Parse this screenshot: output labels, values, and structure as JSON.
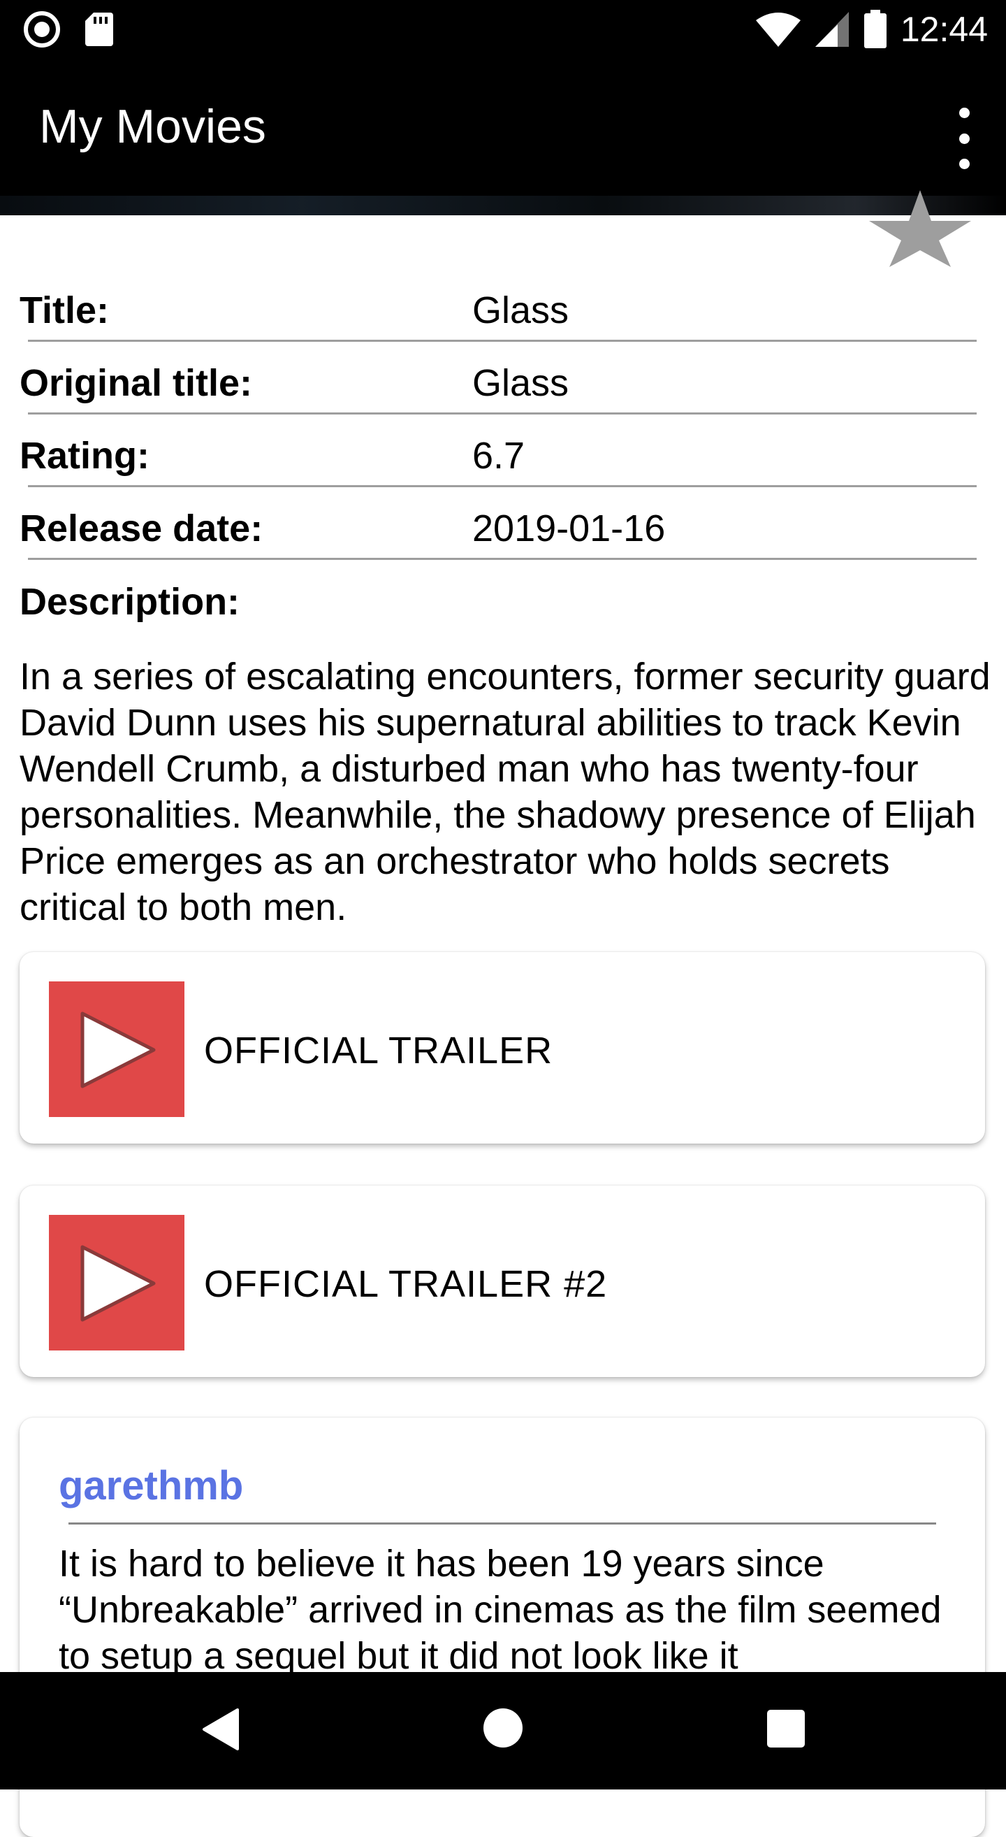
{
  "status_bar": {
    "time": "12:44",
    "icons": [
      "record-icon",
      "sd-card-icon",
      "wifi-icon",
      "signal-icon",
      "battery-icon"
    ]
  },
  "app_bar": {
    "title": "My Movies",
    "menu_icon": "overflow-menu-icon"
  },
  "favorite": {
    "icon": "star-icon",
    "color": "#9e9e9e"
  },
  "details": {
    "rows": [
      {
        "label": "Title:",
        "value": "Glass"
      },
      {
        "label": "Original title:",
        "value": "Glass"
      },
      {
        "label": "Rating:",
        "value": "6.7"
      },
      {
        "label": "Release date:",
        "value": "2019-01-16"
      }
    ],
    "description_label": "Description:",
    "description": "In a series of escalating encounters, former security guard David Dunn uses his supernatural abilities to track Kevin Wendell Crumb, a disturbed man who has twenty-four personalities. Meanwhile, the shadowy presence of Elijah Price emerges as an orchestrator who holds secrets critical to both men."
  },
  "trailers": [
    {
      "name": "OFFICIAL TRAILER",
      "icon": "play-icon"
    },
    {
      "name": "OFFICIAL TRAILER #2",
      "icon": "play-icon"
    }
  ],
  "review": {
    "author": "garethmb",
    "text": "It is hard to believe it has been 19 years since “Unbreakable” arrived in cinemas as the film seemed to setup a sequel but it did not look like it"
  },
  "colors": {
    "accent_link": "#5a73e3",
    "trailer_thumb": "#e04848",
    "bars": "#000000"
  },
  "nav_bar": {
    "icons": [
      "back-icon",
      "home-icon",
      "recents-icon"
    ]
  }
}
